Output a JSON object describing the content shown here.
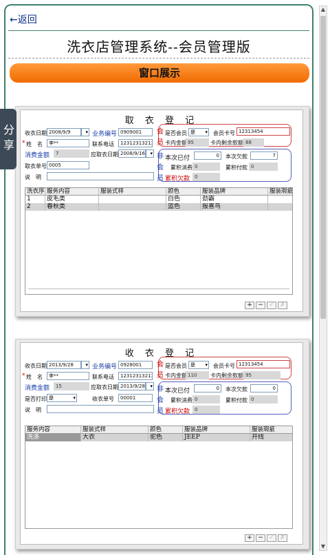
{
  "nav": {
    "back": "←返回"
  },
  "page_title": "洗衣店管理系统--会员管理版",
  "section_button": "窗口展示",
  "share_label": "分享",
  "form1": {
    "title": "取 衣 登 记",
    "date_label": "收衣日期",
    "date_value": "2008/9/9",
    "biz_no_label": "业务编号",
    "biz_no_value": "0909001",
    "name_label": "姓　名",
    "name_value": "李**",
    "phone_label": "联系电话",
    "phone_value": "12312313213",
    "amount_label": "消费金额",
    "amount_value": "7",
    "pickup_date_label": "应取衣日期",
    "pickup_date_value": "2008/9/16",
    "order_no_label": "取衣单号",
    "order_no_value": "0005",
    "note_label": "说　明",
    "member_label": "是否会员",
    "member_value": "是",
    "card_label": "会员卡号",
    "card_value": "12313454",
    "balance_label": "卡内金额",
    "balance_value": "95",
    "deduct_label": "卡内剩余款额",
    "deduct_value": "88",
    "paid_label": "本次已付",
    "paid_value": "0",
    "owed_label": "本次欠款",
    "owed_value": "7",
    "acc_spend_label": "累积消费",
    "acc_spend_value": "0",
    "acc_paid_label": "累积付款",
    "acc_paid_value": "0",
    "acc_debt_label": "累积欠款",
    "acc_debt_value": "0",
    "side_vip": [
      "会",
      "员"
    ],
    "side_nonvip": [
      "非",
      "会",
      "员"
    ],
    "columns": [
      "洗衣序",
      "服务内容",
      "服装式样",
      "颜色",
      "服装品牌",
      "服装瑕疵"
    ],
    "rows": [
      [
        "1",
        "皮毛类",
        "",
        "白色",
        "劲霸",
        ""
      ],
      [
        "2",
        "春秋类",
        "",
        "蓝色",
        "报喜鸟",
        ""
      ]
    ]
  },
  "form2": {
    "title": "收 衣 登 记",
    "date_label": "收衣日期",
    "date_value": "2013/9/28",
    "biz_no_label": "业务编号",
    "biz_no_value": "0928001",
    "name_label": "姓　名",
    "name_value": "李**",
    "phone_label": "联系电话",
    "phone_value": "12312313213",
    "amount_label": "消费金额",
    "amount_value": "15",
    "pickup_date_label": "应取衣日期",
    "pickup_date_value": "2013/9/28",
    "print_label": "是否打印",
    "print_value": "是",
    "order_no_label": "收衣单号",
    "order_no_value": "00001",
    "note_label": "说　明",
    "member_label": "是否会员",
    "member_value": "是",
    "card_label": "会员卡号",
    "card_value": "12313454",
    "balance_label": "卡内金额",
    "balance_value": "110",
    "deduct_label": "卡内剩余款额",
    "deduct_value": "95",
    "paid_label": "本次已付",
    "paid_value": "0",
    "owed_label": "本次欠款",
    "owed_value": "0",
    "acc_spend_label": "累积消费",
    "acc_spend_value": "0",
    "acc_paid_label": "累积付款",
    "acc_paid_value": "0",
    "acc_debt_label": "累积欠款",
    "acc_debt_value": "0",
    "side_vip": [
      "会",
      "员"
    ],
    "side_nonvip": [
      "非",
      "会",
      "员"
    ],
    "columns": [
      "服务内容",
      "服装式样",
      "颜色",
      "服装品牌",
      "服装瑕疵"
    ],
    "rows": [
      [
        "洗涤",
        "大衣",
        "驼色",
        "JEEP",
        "开线"
      ]
    ]
  },
  "toolbar": {
    "add": "+",
    "remove": "−",
    "confirm": "✓",
    "cancel": "✗"
  }
}
